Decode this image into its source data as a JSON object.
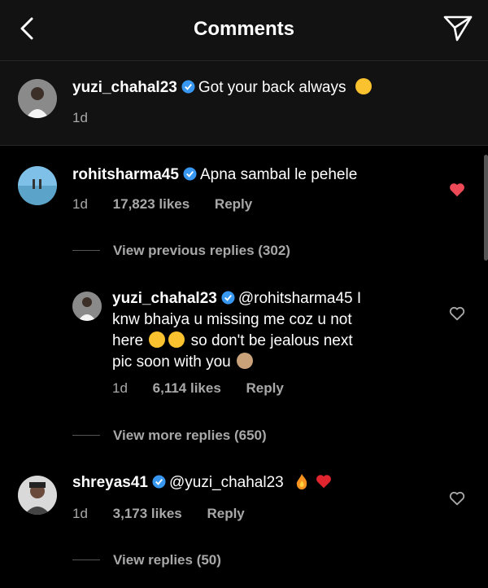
{
  "header": {
    "title": "Comments"
  },
  "caption": {
    "username": "yuzi_chahal23",
    "text": "Got your back always",
    "age": "1d"
  },
  "comments": [
    {
      "username": "rohitsharma45",
      "text": "Apna sambal le pehele",
      "age": "1d",
      "likes": "17,823 likes",
      "reply_label": "Reply",
      "liked": true,
      "view_replies": "View previous replies (302)"
    },
    {
      "username": "yuzi_chahal23",
      "text_line1": "@rohitsharma45 I",
      "text_line2": "knw bhaiya u missing me coz u not",
      "text_line3a": "here",
      "text_line3b": "so don't be jealous next",
      "text_line4": "pic soon with you",
      "age": "1d",
      "likes": "6,114 likes",
      "reply_label": "Reply",
      "liked": false,
      "view_replies": "View more replies (650)"
    },
    {
      "username": "shreyas41",
      "text": "@yuzi_chahal23",
      "age": "1d",
      "likes": "3,173 likes",
      "reply_label": "Reply",
      "liked": false,
      "view_replies": "View replies (50)"
    }
  ],
  "colors": {
    "background": "#000000",
    "header_bg": "#121212",
    "verified": "#3897f0",
    "liked_heart": "#ed4956",
    "muted_text": "#a8a8a8"
  }
}
